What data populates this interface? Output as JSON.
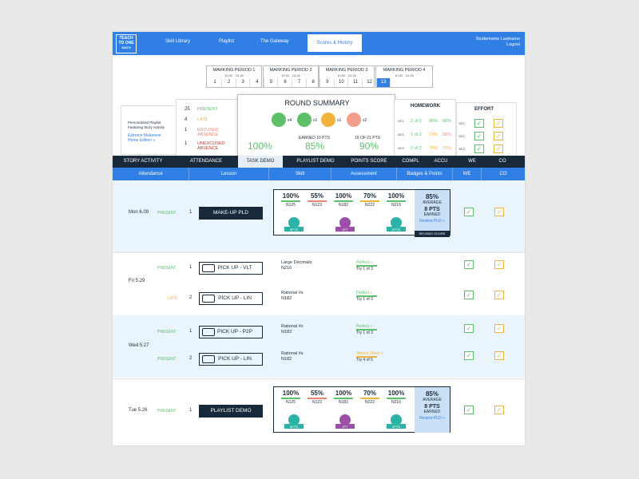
{
  "nav": {
    "logo_line1": "TEACH",
    "logo_line2": "TO",
    "logo_line3": "ONE",
    "logo_line4": "MATH",
    "links": [
      "Skill Library",
      "Playlist",
      "The Gateway"
    ],
    "active": "Scores & History",
    "user": "Studentame Lastname",
    "logout": "Logout"
  },
  "marking_periods": [
    {
      "title": "MARKING PERIOD 1",
      "dates": "10:02 - 10:15",
      "weeks": [
        "1",
        "2",
        "3",
        "4"
      ]
    },
    {
      "title": "MARKING PERIOD 2",
      "dates": "10:02 - 10:15",
      "weeks": [
        "5",
        "6",
        "7",
        "8"
      ]
    },
    {
      "title": "MARKING PERIOD 3",
      "dates": "10:02 - 10:15",
      "weeks": [
        "9",
        "10",
        "11"
      ]
    },
    {
      "title": "MARKING PERIOD 4",
      "dates": "10:02 - 10:15",
      "weeks": [
        "12",
        "13"
      ]
    }
  ],
  "story": {
    "text1": "Personalized Playlist",
    "text2": "Featuring Story Activity",
    "link1": "Extreme Makeover",
    "link2": "Home Edition »"
  },
  "attendance_summary": [
    {
      "n": "25",
      "label": "PRESENT",
      "color": "#5cc06a"
    },
    {
      "n": "4",
      "label": "LATE",
      "color": "#f0b33b"
    },
    {
      "n": "1",
      "label": "EXCUSED ABSENCE",
      "color": "#e9826e"
    },
    {
      "n": "1",
      "label": "UNEXCUSED ABSENCE",
      "color": "#c0392b"
    }
  ],
  "round_summary": {
    "title": "ROUND SUMMARY",
    "counts": [
      "x4",
      "x1",
      "x1",
      "x2"
    ],
    "pct1": "100%",
    "earned_label": "EARNED 10 PTS",
    "pct2": "85%",
    "of_label": "19 OF 21 PTS",
    "pct3": "90%"
  },
  "homework": {
    "title": "HOMEWORK",
    "rows": [
      {
        "wk": "wk1",
        "of": "2 of 2",
        "a": "90%",
        "b": "90%"
      },
      {
        "wk": "wk1",
        "of": "1 of 2",
        "a": "73%",
        "b": "55%"
      },
      {
        "wk": "wk2",
        "of": "2 of 2",
        "a": "70%",
        "b": "70%"
      }
    ]
  },
  "effort": {
    "title": "EFFORT",
    "rows": [
      "wk1",
      "wk1",
      "wk2"
    ]
  },
  "tabs": [
    "STORY ACTIVITY",
    "ATTENDANCE",
    "TASK DEMO",
    "PLAYLIST DEMO",
    "POINTS SCORE",
    "COMPL",
    "ACCU",
    "WE",
    "CO"
  ],
  "columns": [
    "Attendance",
    "Lesson",
    "Skill",
    "Assessment",
    "Badges & Points",
    "WE",
    "CO"
  ],
  "rows": [
    {
      "date": "Mon 6.09",
      "status": "PRESENT",
      "num": "1",
      "lesson": "MAKE-UP PLD",
      "scores": [
        {
          "p": "100%",
          "s": "N125"
        },
        {
          "p": "55%",
          "s": "N123"
        },
        {
          "p": "100%",
          "s": "N182"
        },
        {
          "p": "70%",
          "s": "N222"
        },
        {
          "p": "100%",
          "s": "N216"
        }
      ],
      "avg": "85%",
      "avg_label": "AVERAGE",
      "pts": "8 PTS",
      "earned": "EARNED",
      "review": "Review PLD »",
      "revised": "REVISED SCORE"
    },
    {
      "date": "Fri 5.29",
      "items": [
        {
          "status": "PRESENT",
          "num": "1",
          "lesson": "PICK UP - VLT",
          "skill": "Large Decimals",
          "code": "N216",
          "assess": "Perfect »",
          "try": "Try 1 of 3"
        },
        {
          "status": "LATE",
          "num": "2",
          "lesson": "PICK UP - LIN",
          "skill": "Rational #s",
          "code": "N182",
          "assess": "Perfect »",
          "try": "Try 1 of 3"
        }
      ]
    },
    {
      "date": "Wed 5.27",
      "items": [
        {
          "status": "PRESENT",
          "num": "1",
          "lesson": "PICK UP - P2P",
          "skill": "Rational #s",
          "code": "N182",
          "assess": "Perfect »",
          "try": "Try 1 of 3"
        },
        {
          "status": "PRESENT",
          "num": "2",
          "lesson": "PICK UP - LIN",
          "skill": "Rational #s",
          "code": "N182",
          "assess": "Almost There »",
          "try": "Try 4 of 5"
        }
      ]
    },
    {
      "date": "Tue 5.26",
      "status": "PRESENT",
      "num": "1",
      "lesson": "PLAYLIST DEMO",
      "scores": [
        {
          "p": "100%",
          "s": "N125"
        },
        {
          "p": "55%",
          "s": "N123"
        },
        {
          "p": "100%",
          "s": "N182"
        },
        {
          "p": "70%",
          "s": "N222"
        },
        {
          "p": "100%",
          "s": "N216"
        }
      ],
      "avg": "85%",
      "avg_label": "AVERAGE",
      "pts": "8 PTS",
      "earned": "EARNED",
      "review": "Review PLD »"
    }
  ],
  "badges": [
    "5PTS",
    "1PT",
    "2PTS"
  ],
  "colors": {
    "blue": "#2f7fe5",
    "navy": "#17293a",
    "green": "#5cc06a",
    "yellow": "#f0b33b",
    "salmon": "#e9826e",
    "teal": "#2bb3a8",
    "purple": "#9b4fa8"
  }
}
